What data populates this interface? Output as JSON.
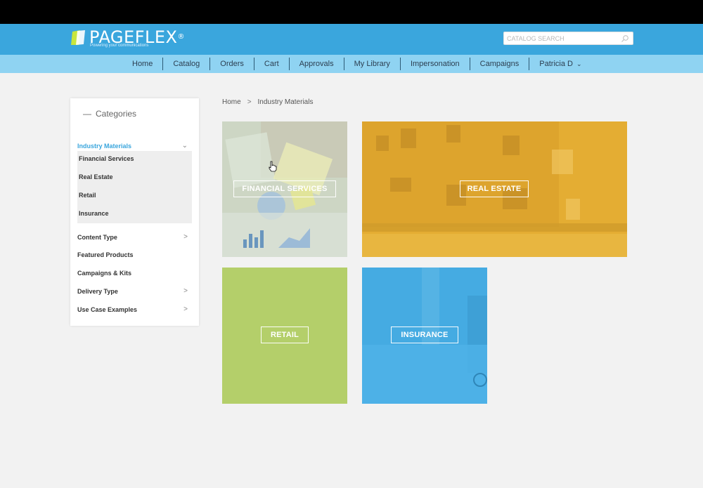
{
  "header": {
    "logo_text": "PAGEFLEX",
    "logo_reg": "®",
    "logo_tagline": "Powering your communications",
    "search_placeholder": "CATALOG SEARCH"
  },
  "nav": {
    "items": [
      "Home",
      "Catalog",
      "Orders",
      "Cart",
      "Approvals",
      "My Library",
      "Impersonation",
      "Campaigns"
    ],
    "user": "Patricia D"
  },
  "sidebar": {
    "title": "Categories",
    "active_item": "Industry Materials",
    "sub_items": [
      "Financial Services",
      "Real Estate",
      "Retail",
      "Insurance"
    ],
    "items": [
      "Content Type",
      "Featured Products",
      "Campaigns & Kits",
      "Delivery Type",
      "Use Case Examples"
    ]
  },
  "breadcrumb": {
    "home": "Home",
    "separator": ">",
    "current": "Industry Materials"
  },
  "tiles": {
    "financial": "FINANCIAL SERVICES",
    "real_estate": "REAL ESTATE",
    "retail": "RETAIL",
    "insurance": "INSURANCE"
  },
  "colors": {
    "header_blue": "#3aa6dd",
    "nav_blue": "#8fd3f2",
    "financial": "#b8cfb8",
    "real_estate": "#e4ad33",
    "retail": "#b4cf6a",
    "insurance": "#45abe2"
  }
}
